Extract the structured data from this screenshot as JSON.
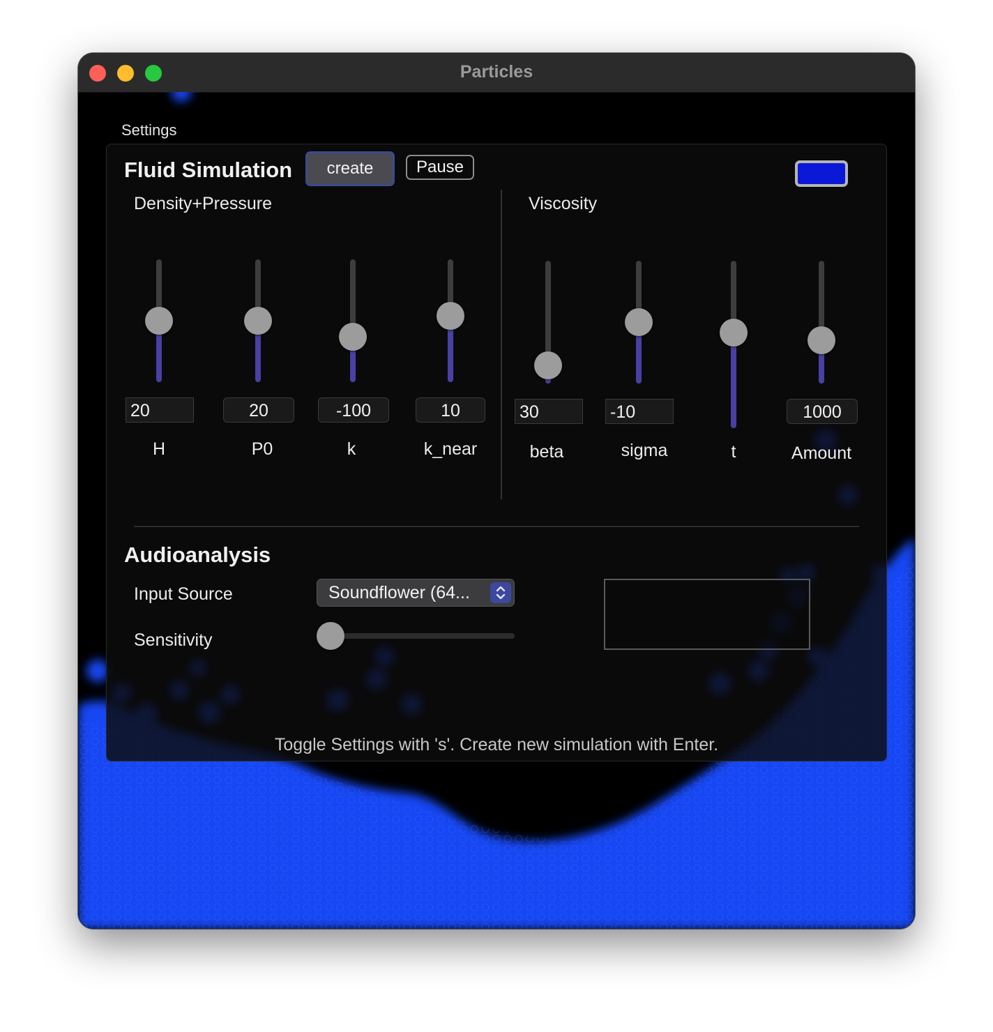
{
  "window": {
    "title": "Particles"
  },
  "settings": {
    "label": "Settings"
  },
  "fluid": {
    "heading": "Fluid Simulation",
    "create_label": "create",
    "pause_label": "Pause",
    "particle_color": "#0a18d8",
    "density_heading": "Density+Pressure",
    "viscosity_heading": "Viscosity"
  },
  "params": {
    "H": {
      "label": "H",
      "value": "20",
      "level": 0.5
    },
    "P0": {
      "label": "P0",
      "value": "20",
      "level": 0.5
    },
    "k": {
      "label": "k",
      "value": "-100",
      "level": 0.37
    },
    "k_near": {
      "label": "k_near",
      "value": "10",
      "level": 0.54
    },
    "beta": {
      "label": "beta",
      "value": "30",
      "level": 0.15
    },
    "sigma": {
      "label": "sigma",
      "value": "-10",
      "level": 0.5
    },
    "t": {
      "label": "t",
      "level": 0.57
    },
    "amount": {
      "label": "Amount",
      "value": "1000",
      "level": 0.35
    }
  },
  "audio": {
    "heading": "Audioanalysis",
    "input_source_label": "Input Source",
    "input_source_value": "Soundflower (64...",
    "sensitivity_label": "Sensitivity",
    "sensitivity_level": 0.0
  },
  "hint": "Toggle Settings with 's'. Create new simulation with Enter.",
  "colors": {
    "fluid": "#1a4cff",
    "slider_fill": "#4840a4",
    "accent": "#3b47a0"
  }
}
